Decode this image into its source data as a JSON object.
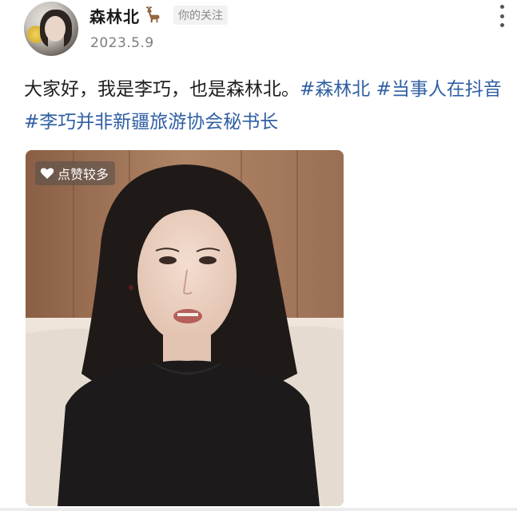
{
  "header": {
    "user_name": "森林北",
    "follow_label": "你的关注",
    "date": "2023.5.9"
  },
  "post": {
    "text_intro": "大家好，我是李巧，也是森林北。",
    "hashtags": [
      "#森林北",
      "#当事人在抖音",
      "#李巧并非新疆旅游协会秘书长"
    ]
  },
  "video": {
    "like_badge_label": "点赞较多"
  },
  "icons": {
    "deer": "deer-icon",
    "more": "more-vertical-icon",
    "heart": "heart-icon"
  },
  "colors": {
    "hashtag": "#2f5fa3",
    "date": "#7d7d7d"
  }
}
